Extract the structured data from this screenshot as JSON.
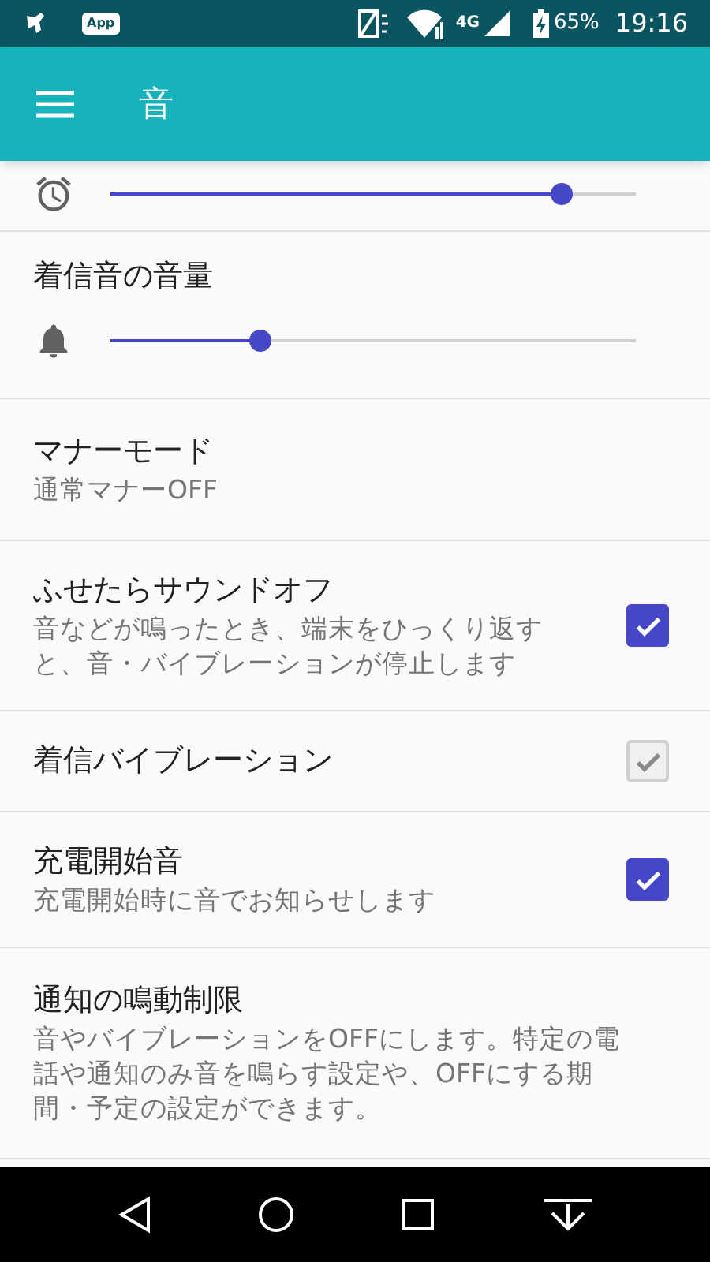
{
  "status_bar": {
    "app_badge": "App",
    "network": "4G",
    "battery": "65%",
    "time": "19:16"
  },
  "app_bar": {
    "title": "音"
  },
  "settings": [
    {
      "kind": "slider",
      "level": 0.86
    },
    {
      "kind": "slider",
      "title": "着信音の音量",
      "level": 0.285
    },
    {
      "kind": "setting",
      "title": "マナーモード",
      "summary": "通常マナーOFF"
    },
    {
      "kind": "checkbox",
      "title": "ふせたらサウンドオフ",
      "summary": "音などが鳴ったとき、端末をひっくり返すと、音・バイブレーションが停止します",
      "checked": true,
      "disabled": false
    },
    {
      "kind": "checkbox",
      "title": "着信バイブレーション",
      "checked": true,
      "disabled": true
    },
    {
      "kind": "checkbox",
      "title": "充電開始音",
      "summary": "充電開始時に音でお知らせします",
      "checked": true,
      "disabled": false
    },
    {
      "kind": "setting",
      "title": "通知の鳴動制限",
      "summary": "音やバイブレーションをOFFにします。特定の電話や通知のみ音を鳴らす設定や、OFFにする期間・予定の設定ができます。"
    }
  ]
}
